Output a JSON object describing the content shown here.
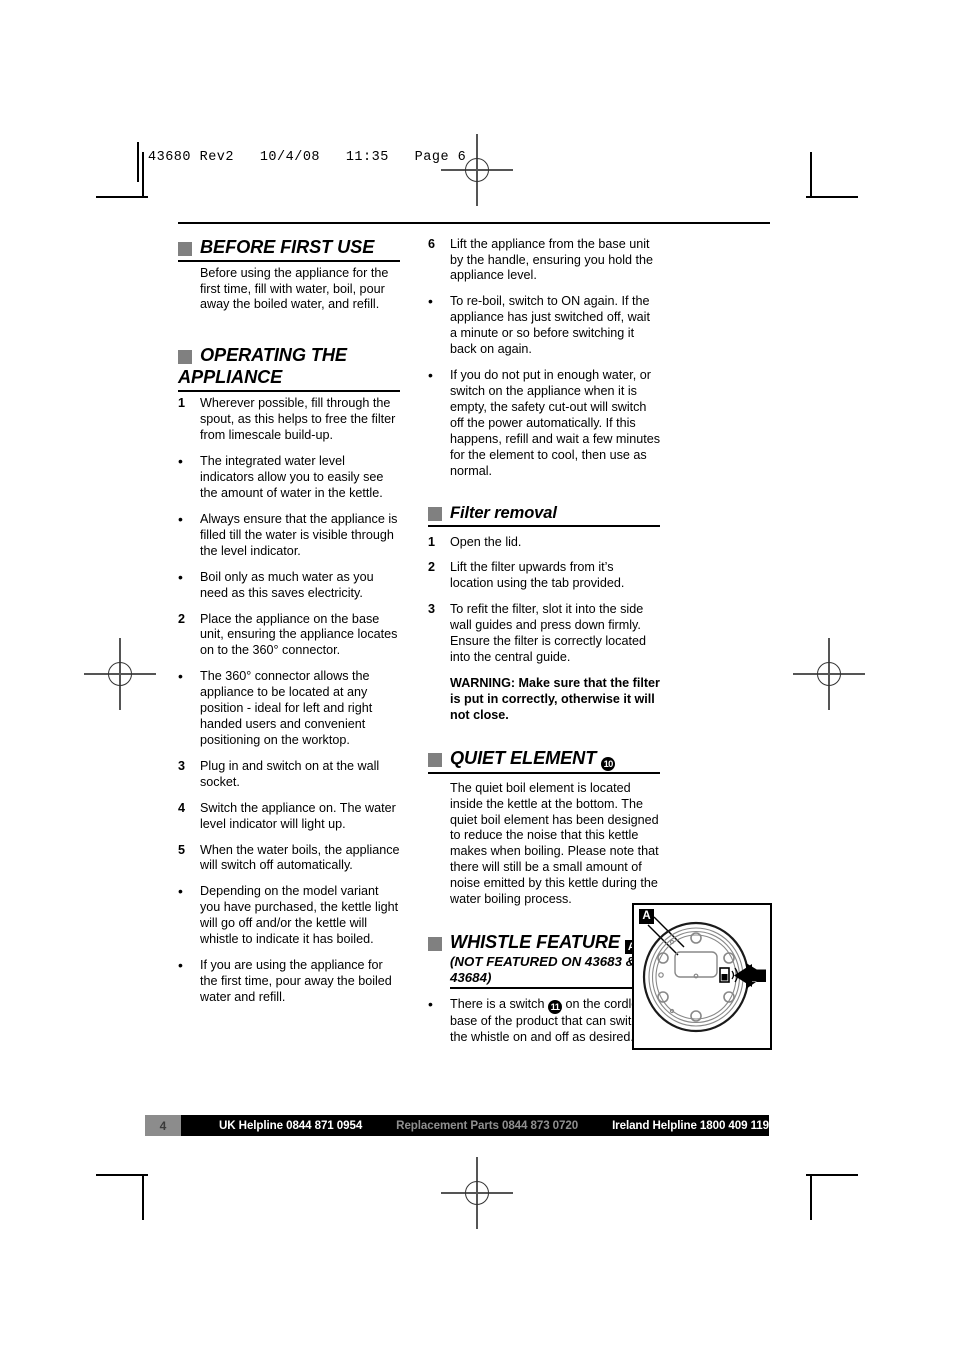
{
  "header": {
    "slug": "43680 Rev2   10/4/08   11:35   Page 6"
  },
  "sections": {
    "before_first_use": {
      "title": "BEFORE FIRST USE",
      "body": "Before using the appliance for the first time, fill with water, boil, pour away the boiled water, and refill."
    },
    "operating_the_appliance": {
      "title": "OPERATING THE APPLIANCE",
      "items": [
        {
          "marker": "1",
          "type": "number",
          "text": "Wherever possible, fill through the spout, as this helps to free the filter from limescale build-up."
        },
        {
          "marker": "•",
          "type": "bullet",
          "text": "The integrated water level indicators allow you to easily see the amount of water in the kettle."
        },
        {
          "marker": "•",
          "type": "bullet",
          "text": "Always ensure that the appliance is filled till the water is visible through the level indicator."
        },
        {
          "marker": "•",
          "type": "bullet",
          "text": "Boil only as much water as you need as this saves electricity."
        },
        {
          "marker": "2",
          "type": "number",
          "text": "Place the appliance on the base unit, ensuring the appliance locates on to the 360° connector."
        },
        {
          "marker": "•",
          "type": "bullet",
          "text": "The 360° connector allows the appliance to be located at any position - ideal for left and right handed users and convenient positioning on the worktop."
        },
        {
          "marker": "3",
          "type": "number",
          "text": "Plug in and switch on at the wall socket."
        },
        {
          "marker": "4",
          "type": "number",
          "text": "Switch the appliance on. The water level indicator will light up."
        },
        {
          "marker": "5",
          "type": "number",
          "text": "When the water boils, the appliance will switch off automatically."
        },
        {
          "marker": "•",
          "type": "bullet",
          "text": "Depending on the model variant you have purchased, the kettle light will go off and/or the kettle will whistle to indicate it has boiled."
        },
        {
          "marker": "•",
          "type": "bullet",
          "text": "If you are using the appliance for the first time, pour away the boiled water and refill."
        }
      ],
      "continued_items": [
        {
          "marker": "6",
          "type": "number",
          "text": "Lift the appliance from the base unit by the handle, ensuring you hold the appliance level."
        },
        {
          "marker": "•",
          "type": "bullet",
          "text": "To re-boil, switch to ON again. If the appliance has just switched off, wait a minute or so before switching it back on again."
        },
        {
          "marker": "•",
          "type": "bullet",
          "text": "If you do not put in enough water, or switch on the appliance when it is empty, the safety cut-out will switch off the power automatically. If this happens, refill and wait a few minutes for the element to cool, then use as normal."
        }
      ]
    },
    "filter_removal": {
      "title": "Filter removal",
      "items": [
        {
          "marker": "1",
          "type": "number",
          "text": "Open the lid."
        },
        {
          "marker": "2",
          "type": "number",
          "text": "Lift the filter upwards from it’s location using the tab provided."
        },
        {
          "marker": "3",
          "type": "number",
          "text": "To refit the filter, slot it into the side wall guides and press down firmly. Ensure the filter is correctly located into the central guide."
        }
      ],
      "warning": "WARNING: Make sure that the filter is put in correctly, otherwise it will not close."
    },
    "quiet_element": {
      "title": "QUIET ELEMENT",
      "badge": "10",
      "body": "The quiet boil element is located inside the kettle at the bottom. The quiet boil element has been designed to reduce the noise that this kettle makes when boiling. Please note that there will still be a small amount of noise emitted by this kettle during the water boiling process."
    },
    "whistle_feature": {
      "title": "WHISTLE FEATURE",
      "badge": "A",
      "subtitle": "(NOT FEATURED ON 43683 & 43684)",
      "item_marker": "•",
      "item_text_before": "There is a switch",
      "item_badge": "11",
      "item_text_after": "on the cordless base of the product that can switch the whistle on and off as desired."
    }
  },
  "figure": {
    "badge": "A"
  },
  "footer": {
    "page_number": "4",
    "uk_helpline": "UK Helpline 0844 871 0954",
    "replacement_parts": "Replacement Parts 0844 873 0720",
    "ireland_helpline": "Ireland Helpline 1800 409 119"
  },
  "colors": {
    "heading_square": "#808080",
    "footer_bar": "#000000",
    "footer_page_box": "#8c8c8c",
    "footer_gray_text": "#8f8f8f"
  }
}
